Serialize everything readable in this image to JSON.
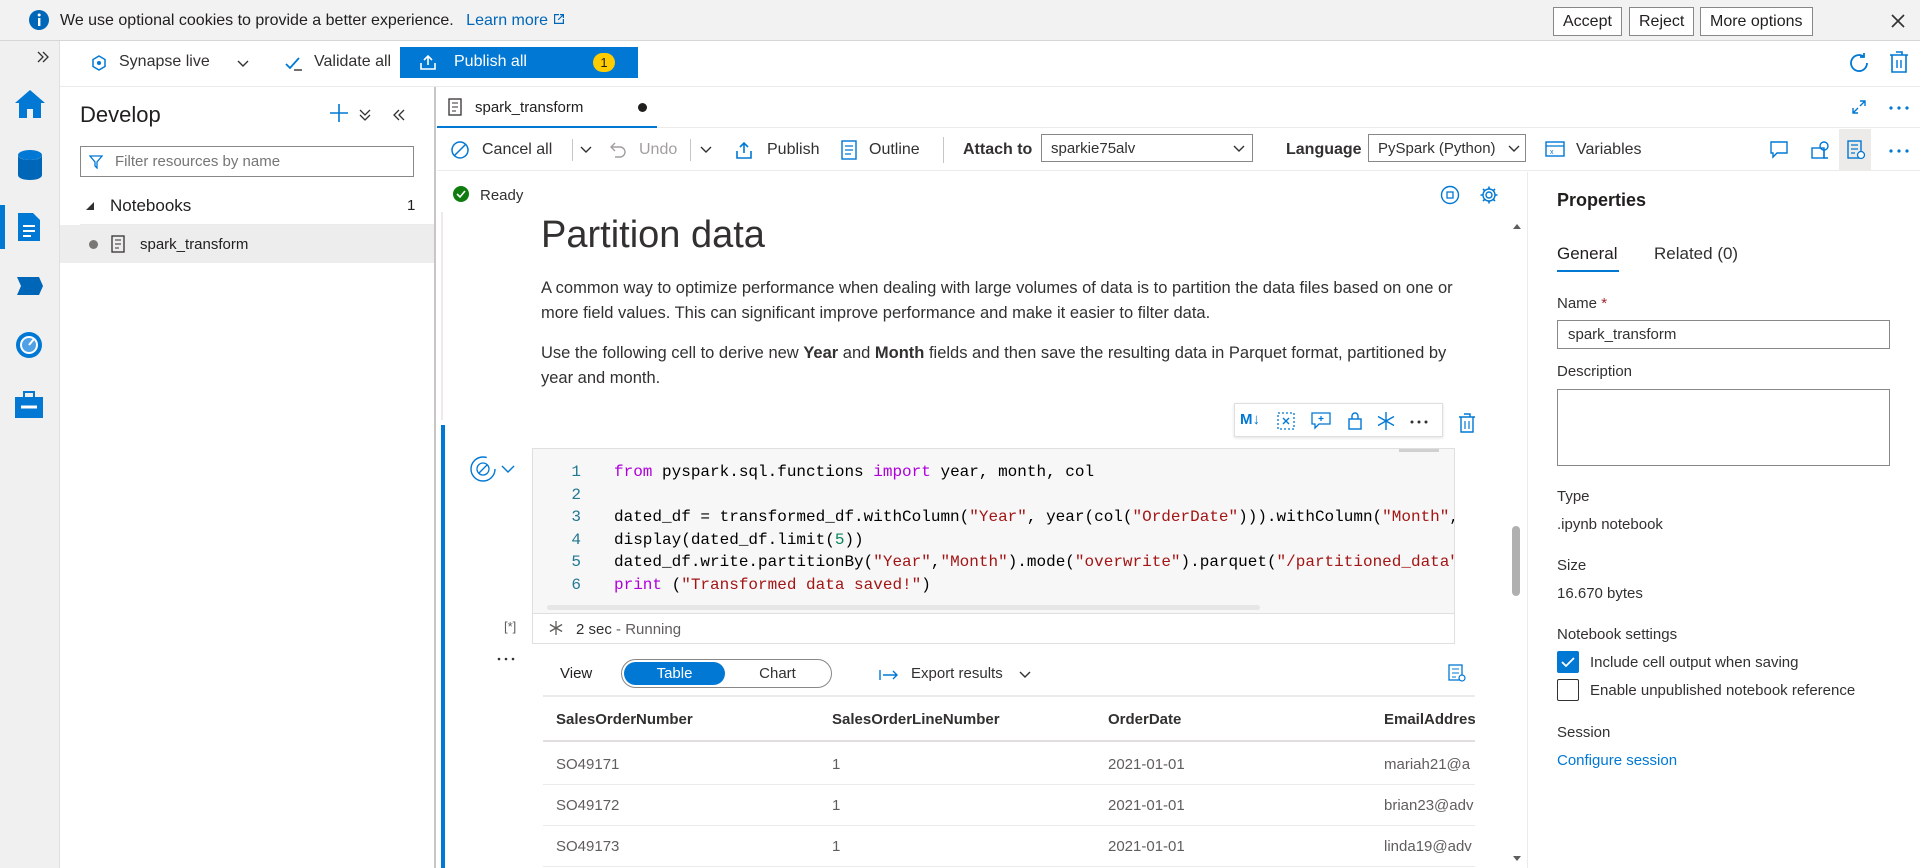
{
  "cookie_banner": {
    "message": "We use optional cookies to provide a better experience.",
    "learn_more": "Learn more",
    "accept": "Accept",
    "reject": "Reject",
    "more_options": "More options"
  },
  "toolbar": {
    "workspace": "Synapse live",
    "validate_all": "Validate all",
    "publish_all": "Publish all",
    "publish_count": "1"
  },
  "develop": {
    "title": "Develop",
    "filter_placeholder": "Filter resources by name",
    "section": "Notebooks",
    "section_count": "1",
    "items": [
      {
        "label": "spark_transform"
      }
    ]
  },
  "tab": {
    "label": "spark_transform"
  },
  "notebook_toolbar": {
    "cancel_all": "Cancel all",
    "undo": "Undo",
    "publish": "Publish",
    "outline": "Outline",
    "attach_to_label": "Attach to",
    "attach_to_value": "sparkie75alv",
    "language_label": "Language",
    "language_value": "PySpark (Python)",
    "variables": "Variables"
  },
  "status": {
    "text": "Ready"
  },
  "markdown": {
    "heading": "Partition data",
    "p1": "A common way to optimize performance when dealing with large volumes of data is to partition the data files based on one or more field values. This can significant improve performance and make it easier to filter data.",
    "p2_a": "Use the following cell to derive new ",
    "p2_b": "Year",
    "p2_c": " and ",
    "p2_d": "Month",
    "p2_e": " fields and then save the resulting data in Parquet format, partitioned by year and month."
  },
  "cell_toolbar": {
    "md_label": "M↓"
  },
  "code_cell": {
    "line_numbers": [
      "1",
      "2",
      "3",
      "4",
      "5",
      "6"
    ],
    "exec_marker": "[*]",
    "run_time": "2 sec",
    "run_status": "- Running"
  },
  "results": {
    "view_label": "View",
    "table_tab": "Table",
    "chart_tab": "Chart",
    "export": "Export results",
    "columns": [
      "SalesOrderNumber",
      "SalesOrderLineNumber",
      "OrderDate",
      "EmailAddres"
    ],
    "rows": [
      [
        "SO49171",
        "1",
        "2021-01-01",
        "mariah21@a"
      ],
      [
        "SO49172",
        "1",
        "2021-01-01",
        "brian23@adv"
      ],
      [
        "SO49173",
        "1",
        "2021-01-01",
        "linda19@adv"
      ]
    ]
  },
  "properties": {
    "title": "Properties",
    "tab_general": "General",
    "tab_related": "Related (0)",
    "name_label": "Name",
    "required_mark": "*",
    "name_value": "spark_transform",
    "description_label": "Description",
    "type_label": "Type",
    "type_value": ".ipynb notebook",
    "size_label": "Size",
    "size_value": "16.670 bytes",
    "settings_label": "Notebook settings",
    "include_output": "Include cell output when saving",
    "include_output_checked": true,
    "enable_unpublished": "Enable unpublished notebook reference",
    "enable_unpublished_checked": false,
    "session_label": "Session",
    "configure_session": "Configure session"
  },
  "colors": {
    "accent": "#0078d4",
    "rail": "#f0f0f0",
    "ready": "#107c10"
  }
}
